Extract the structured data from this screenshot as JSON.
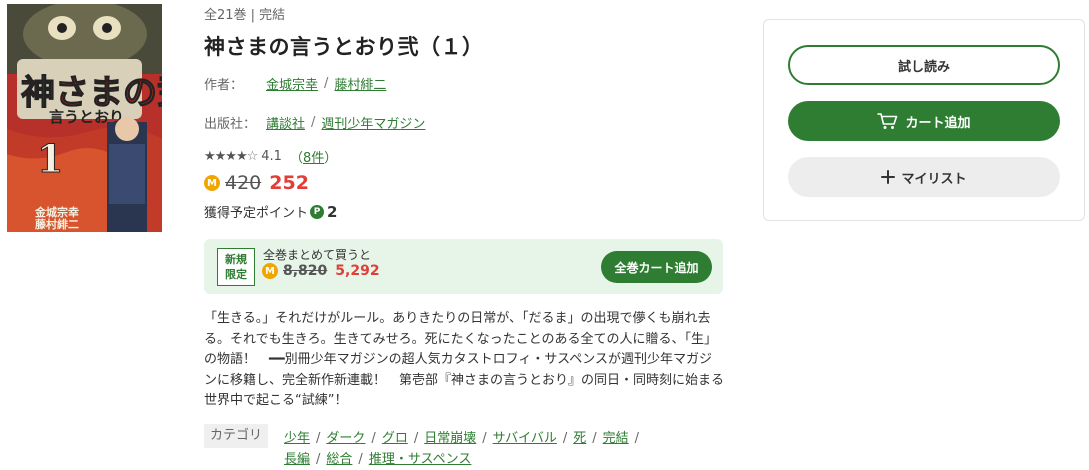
{
  "product": {
    "volume_info": "全21巻 | 完結",
    "title": "神さまの言うとおり弐（１）",
    "cover_alt": "神さまの言うとおり弐 1 cover",
    "author_label": "作者：",
    "authors": [
      "金城宗幸",
      "藤村緋二"
    ],
    "publisher_label": "出版社：",
    "publishers": [
      "講談社",
      "週刊少年マガジン"
    ],
    "rating": {
      "stars_full": "★★★★",
      "stars_empty": "☆",
      "value": "4.1",
      "count_open": "（",
      "count": "8件",
      "count_close": "）"
    },
    "price": {
      "coin_icon": "M",
      "original": "420",
      "sale": "252"
    },
    "points": {
      "label": "獲得予定ポイント",
      "icon": "P",
      "value": "2"
    }
  },
  "bundle": {
    "badge_line1": "新規",
    "badge_line2": "限定",
    "label": "全巻まとめて買うと",
    "coin_icon": "M",
    "original": "8,820",
    "sale": "5,292",
    "button_label": "全巻カート追加"
  },
  "description": "「生きる。」それだけがルール。ありきたりの日常が、「だるま」の出現で儚くも崩れ去る。それでも生きろ。生きてみせろ。死にたくなったことのある全ての人に贈る、「生」の物語！　━━別冊少年マガジンの超人気カタストロフィ・サスペンスが週刊少年マガジンに移籍し、完全新作新連載！　第壱部『神さまの言うとおり』の同日・同時刻に始まる世界中で起こる“試練”！",
  "categories": {
    "label": "カテゴリ",
    "tags": [
      "少年",
      "ダーク",
      "グロ",
      "日常崩壊",
      "サバイバル",
      "死",
      "完結",
      "長編",
      "総合",
      "推理・サスペンス"
    ]
  },
  "sidebar": {
    "trial_label": "試し読み",
    "cart_label": "カート追加",
    "cart_icon": "cart-icon",
    "mylist_label": "マイリスト",
    "mylist_icon": "plus-icon"
  },
  "colors": {
    "accent_green": "#2e7d32",
    "price_red": "#e03e36",
    "coin_orange": "#f0a500",
    "bundle_bg": "#e7f4e8"
  }
}
